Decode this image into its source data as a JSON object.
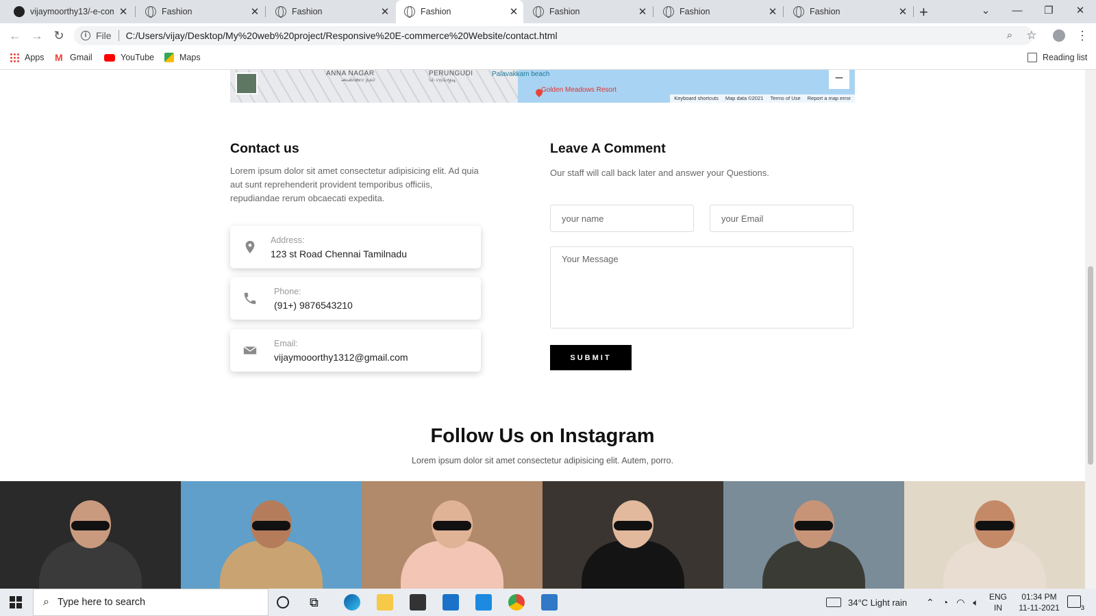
{
  "browser": {
    "tabs": [
      {
        "title": "vijaymoorthy13/-e-com",
        "active": false,
        "icon": "github-icon"
      },
      {
        "title": "Fashion",
        "active": false,
        "icon": "globe-icon"
      },
      {
        "title": "Fashion",
        "active": false,
        "icon": "globe-icon"
      },
      {
        "title": "Fashion",
        "active": true,
        "icon": "globe-icon"
      },
      {
        "title": "Fashion",
        "active": false,
        "icon": "globe-icon"
      },
      {
        "title": "Fashion",
        "active": false,
        "icon": "globe-icon"
      },
      {
        "title": "Fashion",
        "active": false,
        "icon": "globe-icon"
      }
    ],
    "address_prefix": "File",
    "url": "C:/Users/vijay/Desktop/My%20web%20project/Responsive%20E-commerce%20Website/contact.html",
    "bookmarks": [
      "Apps",
      "Gmail",
      "YouTube",
      "Maps"
    ],
    "reading_list": "Reading list"
  },
  "map": {
    "labels": [
      "ANNA NAGAR",
      "அண்ணா நகர்",
      "PERUNGUDI",
      "பெருங்குடி",
      "Palavakkam beach",
      "Golden Meadows Resort"
    ],
    "footer": [
      "Keyboard shortcuts",
      "Map data ©2021",
      "Terms of Use",
      "Report a map error"
    ],
    "zoom_out": "−"
  },
  "contact": {
    "title": "Contact us",
    "description": "Lorem ipsum dolor sit amet consectetur adipisicing elit. Ad quia aut sunt reprehenderit provident temporibus officiis, repudiandae rerum obcaecati expedita.",
    "cards": [
      {
        "label": "Address:",
        "value": "123 st Road Chennai Tamilnadu",
        "icon": "map-marker-icon"
      },
      {
        "label": "Phone:",
        "value": "(91+) 9876543210",
        "icon": "phone-icon"
      },
      {
        "label": "Email:",
        "value": "vijaymooorthy1312@gmail.com",
        "icon": "envelope-icon"
      }
    ]
  },
  "comment": {
    "title": "Leave A Comment",
    "description": "Our staff will call back later and answer your Questions.",
    "name_placeholder": "your name",
    "email_placeholder": "your Email",
    "message_placeholder": "Your Message",
    "submit_label": "SUBMIT"
  },
  "instagram": {
    "title": "Follow Us on Instagram",
    "subtitle": "Lorem ipsum dolor sit amet consectetur adipisicing elit. Autem, porro.",
    "photos": [
      {
        "bg": "#2a2a2a",
        "skin": "#c99a7e",
        "top": "#3a3a3a"
      },
      {
        "bg": "#5f9fc9",
        "skin": "#b57c5c",
        "top": "#c9a472"
      },
      {
        "bg": "#b08a6a",
        "skin": "#e0b296",
        "top": "#f2c5b5"
      },
      {
        "bg": "#3a3530",
        "skin": "#e2b99c",
        "top": "#141414"
      },
      {
        "bg": "#7a8c98",
        "skin": "#c89478",
        "top": "#3b3b35"
      },
      {
        "bg": "#e2d8c8",
        "skin": "#c48a68",
        "top": "#e8ddd0"
      }
    ]
  },
  "taskbar": {
    "search_placeholder": "Type here to search",
    "weather": "34°C  Light rain",
    "lang": "ENG",
    "region": "IN",
    "time": "01:34 PM",
    "date": "11-11-2021",
    "notifications": "3"
  }
}
